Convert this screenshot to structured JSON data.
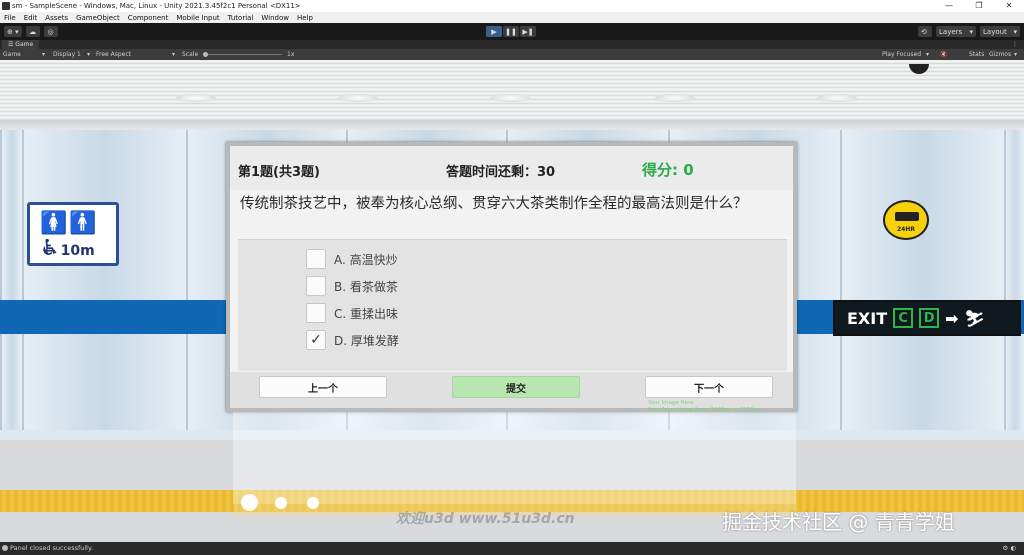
{
  "window": {
    "title": "sm - SampleScene - Windows, Mac, Linux - Unity 2021.3.45f2c1 Personal <DX11>",
    "controls": [
      "—",
      "❐",
      "✕"
    ]
  },
  "menu": [
    "File",
    "Edit",
    "Assets",
    "GameObject",
    "Component",
    "Mobile Input",
    "Tutorial",
    "Window",
    "Help"
  ],
  "toolbar": {
    "account": "⊕ ▾",
    "layers_label": "Layers",
    "layout_label": "Layout"
  },
  "game_tab": {
    "label": "Game"
  },
  "game_toolbar": {
    "view": "Game",
    "display": "Display 1",
    "aspect": "Free Aspect",
    "scale_label": "Scale",
    "scale_value": "1x",
    "play_focused": "Play Focused",
    "stats": "Stats",
    "gizmos": "Gizmos"
  },
  "scene": {
    "restroom_distance": "10m",
    "cctv_label": "24HR",
    "exit_text": "EXIT",
    "exit_c": "C",
    "exit_d": "D"
  },
  "quiz": {
    "question_number": "第1题(共3题)",
    "timer": "答题时间还剩：30",
    "score": "得分: 0",
    "question": "传统制茶技艺中，被奉为核心总纲、贯穿六大茶类制作全程的最高法则是什么？",
    "options": [
      {
        "label": "A. 高温快炒",
        "checked": ""
      },
      {
        "label": "B. 看茶做茶",
        "checked": ""
      },
      {
        "label": "C. 重揉出味",
        "checked": ""
      },
      {
        "label": "D. 厚堆发酵",
        "checked": "✓"
      }
    ],
    "prev_button": "上一个",
    "submit_button": "提交",
    "next_button": "下一个",
    "ad_line1": "Your Image Here",
    "ad_line2": "Free Advertising Area: 2400px × 1350px"
  },
  "watermarks": {
    "site": "欢迎u3d www.51u3d.cn",
    "community": "掘金技术社区 @ 青青学姐"
  },
  "status": {
    "message": "Panel closed successfully."
  }
}
